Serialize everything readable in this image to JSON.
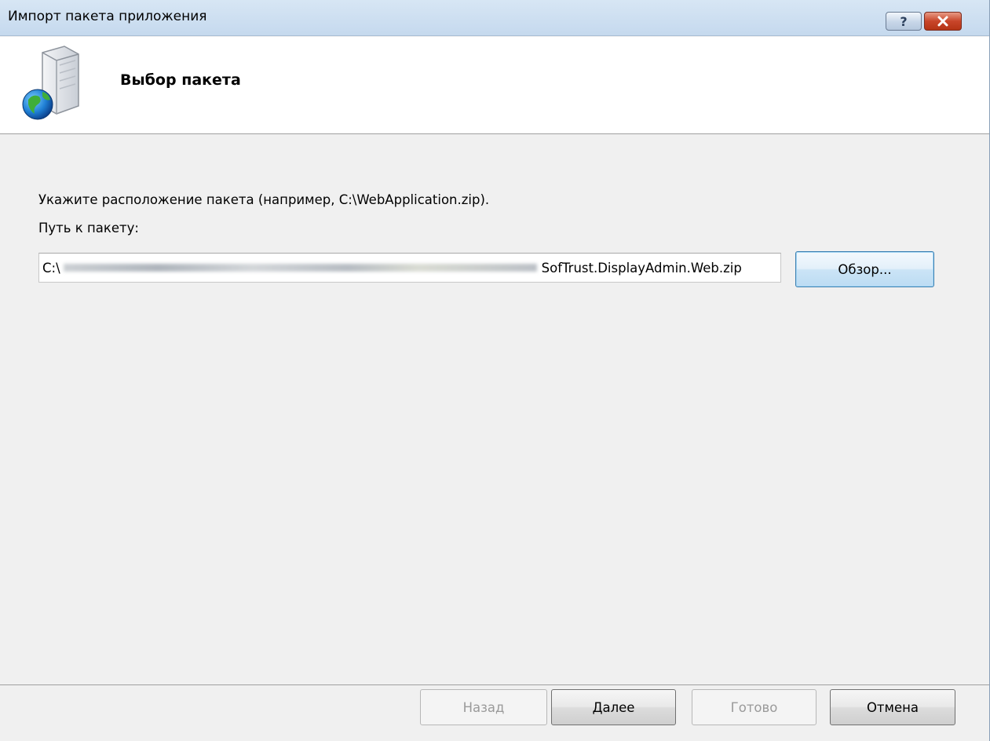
{
  "window": {
    "title": "Импорт пакета приложения",
    "help_label": "?",
    "close_label": "✕"
  },
  "header": {
    "title": "Выбор пакета",
    "icon": "package-globe-icon"
  },
  "body": {
    "instruction": "Укажите расположение пакета (например, C:\\WebApplication.zip).",
    "path_label": "Путь к пакету:",
    "path_prefix": "C:\\",
    "path_suffix": "SofTrust.DisplayAdmin.Web.zip",
    "browse_label": "Обзор..."
  },
  "footer": {
    "back_label": "Назад",
    "next_label": "Далее",
    "finish_label": "Готово",
    "cancel_label": "Отмена"
  }
}
